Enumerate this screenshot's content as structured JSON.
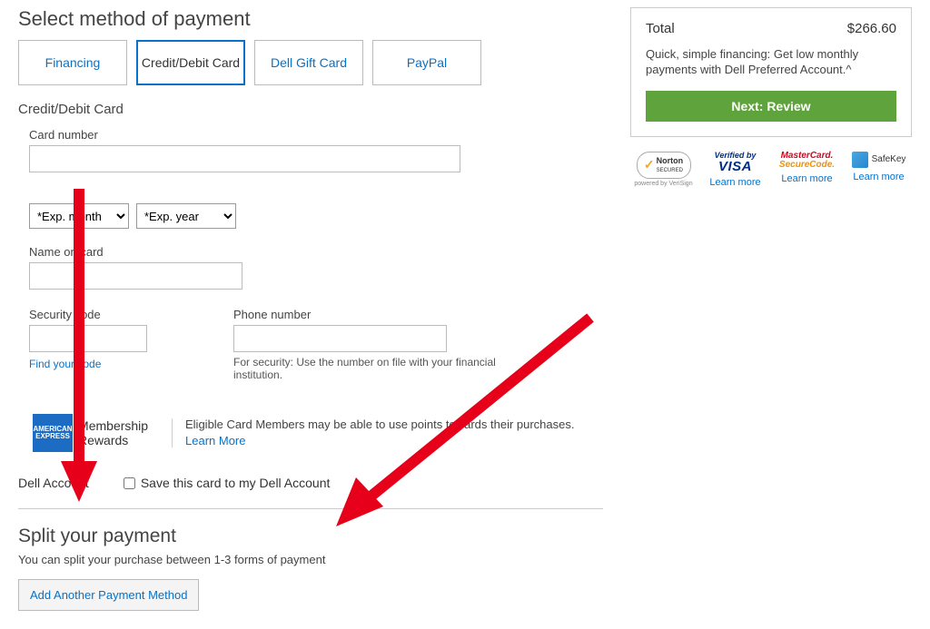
{
  "payment": {
    "heading": "Select method of payment",
    "tabs": [
      "Financing",
      "Credit/Debit Card",
      "Dell Gift Card",
      "PayPal"
    ],
    "active_tab": "Credit/Debit Card",
    "card_section_label": "Credit/Debit Card",
    "card_number_label": "Card number",
    "exp_month_placeholder": "*Exp. month",
    "exp_year_placeholder": "*Exp. year",
    "name_label": "Name on card",
    "seccode_label": "Security code",
    "find_code_link": "Find your code",
    "phone_label": "Phone number",
    "phone_hint": "For security: Use the number on file with your financial institution.",
    "amex_badge_line1": "AMERICAN",
    "amex_badge_line2": "EXPRESS",
    "amex_text_line1": "Membership",
    "amex_text_line2": "Rewards",
    "amex_desc_prefix": "Eligible Card Members may be able to use points towards their purchases. ",
    "amex_learn_more": "Learn More",
    "dell_account_label": "Dell Account",
    "save_card_label": "Save this card to my Dell Account"
  },
  "split": {
    "heading": "Split your payment",
    "desc": "You can split your purchase between 1-3 forms of payment",
    "button": "Add Another Payment Method"
  },
  "summary": {
    "total_label": "Total",
    "total_value": "$266.60",
    "financing_blurb": "Quick, simple financing: Get low monthly payments with Dell Preferred Account.^",
    "next_button": "Next: Review"
  },
  "trust": {
    "norton": "Norton",
    "norton_sub_a": "SECURED",
    "norton_sub_b": "powered by VeriSign",
    "vbv_top": "Verified by",
    "vbv_bottom": "VISA",
    "msc_top": "MasterCard.",
    "msc_bottom": "SecureCode.",
    "safekey": "SafeKey",
    "learn_more": "Learn more"
  }
}
